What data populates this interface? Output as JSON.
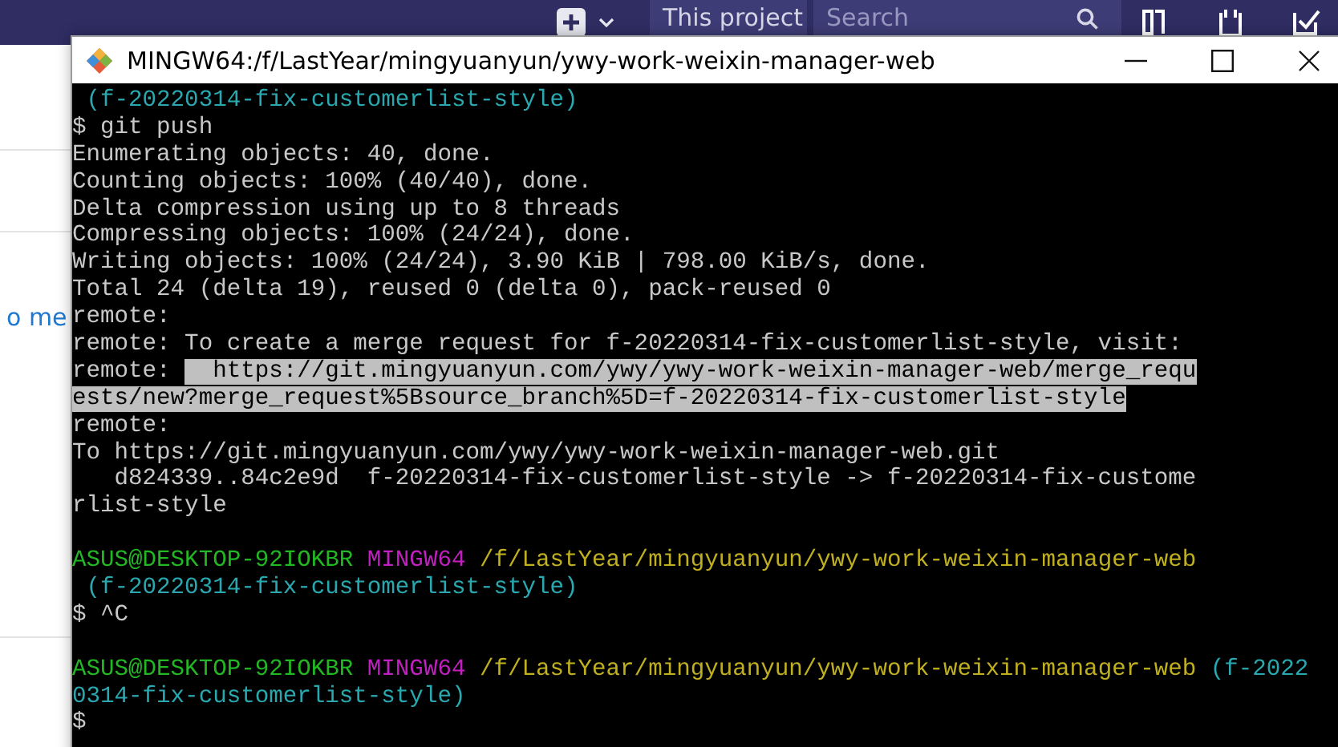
{
  "nav": {
    "scope_button": "This project",
    "search": {
      "placeholder": "Search"
    }
  },
  "page": {
    "side_link": "o me"
  },
  "terminal": {
    "title": "MINGW64:/f/LastYear/mingyuanyun/ywy-work-weixin-manager-web",
    "lines": [
      {
        "segments": [
          {
            "kind": "branch",
            "text": " (f-20220314-fix-customerlist-style)"
          }
        ]
      },
      {
        "segments": [
          {
            "kind": "output",
            "text": "$ git push"
          }
        ]
      },
      {
        "segments": [
          {
            "kind": "output",
            "text": "Enumerating objects: 40, done."
          }
        ]
      },
      {
        "segments": [
          {
            "kind": "output",
            "text": "Counting objects: 100% (40/40), done."
          }
        ]
      },
      {
        "segments": [
          {
            "kind": "output",
            "text": "Delta compression using up to 8 threads"
          }
        ]
      },
      {
        "segments": [
          {
            "kind": "output",
            "text": "Compressing objects: 100% (24/24), done."
          }
        ]
      },
      {
        "segments": [
          {
            "kind": "output",
            "text": "Writing objects: 100% (24/24), 3.90 KiB | 798.00 KiB/s, done."
          }
        ]
      },
      {
        "segments": [
          {
            "kind": "output",
            "text": "Total 24 (delta 19), reused 0 (delta 0), pack-reused 0"
          }
        ]
      },
      {
        "segments": [
          {
            "kind": "output",
            "text": "remote:"
          }
        ]
      },
      {
        "segments": [
          {
            "kind": "output",
            "text": "remote: To create a merge request for f-20220314-fix-customerlist-style, visit:"
          }
        ]
      },
      {
        "segments": [
          {
            "kind": "output",
            "text": "remote: "
          },
          {
            "kind": "selection",
            "text": "  https://git.mingyuanyun.com/ywy/ywy-work-weixin-manager-web/merge_requ"
          }
        ]
      },
      {
        "segments": [
          {
            "kind": "selection",
            "text": "ests/new?merge_request%5Bsource_branch%5D=f-20220314-fix-customerlist-style"
          }
        ]
      },
      {
        "segments": [
          {
            "kind": "output",
            "text": "remote:"
          }
        ]
      },
      {
        "segments": [
          {
            "kind": "output",
            "text": "To https://git.mingyuanyun.com/ywy/ywy-work-weixin-manager-web.git"
          }
        ]
      },
      {
        "segments": [
          {
            "kind": "output",
            "text": "   d824339..84c2e9d  f-20220314-fix-customerlist-style -> f-20220314-fix-custome"
          }
        ]
      },
      {
        "segments": [
          {
            "kind": "output",
            "text": "rlist-style"
          }
        ]
      },
      {
        "kind": "blank"
      },
      {
        "segments": [
          {
            "kind": "user",
            "text": "ASUS@DESKTOP-92IOKBR"
          },
          {
            "kind": "host",
            "text": " MINGW64"
          },
          {
            "kind": "path",
            "text": " /f/LastYear/mingyuanyun/ywy-work-weixin-manager-web"
          }
        ]
      },
      {
        "segments": [
          {
            "kind": "branch",
            "text": " (f-20220314-fix-customerlist-style)"
          }
        ]
      },
      {
        "segments": [
          {
            "kind": "output",
            "text": "$ ^C"
          }
        ]
      },
      {
        "kind": "blank"
      },
      {
        "segments": [
          {
            "kind": "user",
            "text": "ASUS@DESKTOP-92IOKBR"
          },
          {
            "kind": "host",
            "text": " MINGW64"
          },
          {
            "kind": "path",
            "text": " /f/LastYear/mingyuanyun/ywy-work-weixin-manager-web"
          },
          {
            "kind": "branch",
            "text": " (f-2022"
          }
        ]
      },
      {
        "segments": [
          {
            "kind": "branch",
            "text": "0314-fix-customerlist-style)"
          }
        ]
      },
      {
        "segments": [
          {
            "kind": "output",
            "text": "$"
          }
        ]
      }
    ]
  }
}
